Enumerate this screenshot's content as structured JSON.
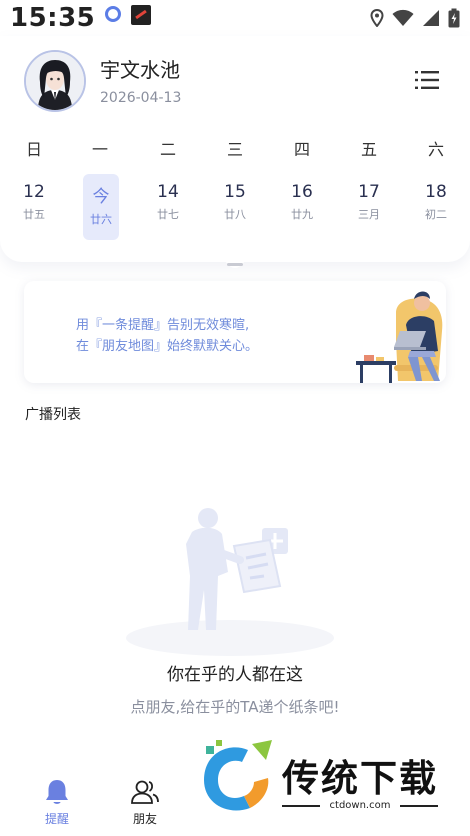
{
  "status_bar": {
    "time": "15:35"
  },
  "profile": {
    "name": "宇文水池",
    "date": "2026-04-13"
  },
  "calendar": {
    "weekdays": [
      "日",
      "一",
      "二",
      "三",
      "四",
      "五",
      "六"
    ],
    "days": [
      {
        "num": "12",
        "lunar": "廿五",
        "selected": false
      },
      {
        "num": "今",
        "lunar": "廿六",
        "selected": true
      },
      {
        "num": "14",
        "lunar": "廿七",
        "selected": false
      },
      {
        "num": "15",
        "lunar": "廿八",
        "selected": false
      },
      {
        "num": "16",
        "lunar": "廿九",
        "selected": false
      },
      {
        "num": "17",
        "lunar": "三月",
        "selected": false
      },
      {
        "num": "18",
        "lunar": "初二",
        "selected": false
      }
    ]
  },
  "banner": {
    "line1": "用『一条提醒』告别无效寒暄,",
    "line2": "在『朋友地图』始终默默关心。"
  },
  "broadcast": {
    "section_title": "广播列表",
    "empty_title": "你在乎的人都在这",
    "empty_subtitle": "点朋友,给在乎的TA递个纸条吧!"
  },
  "bottom_nav": {
    "items": [
      {
        "label": "提醒",
        "icon": "bell-icon",
        "active": true
      },
      {
        "label": "朋友",
        "icon": "friends-icon",
        "active": false
      }
    ]
  },
  "watermark": {
    "text": "传统下载",
    "url": "ctdown.com"
  },
  "colors": {
    "accent": "#6a80e0",
    "selected_bg": "#e6eafb",
    "muted": "#8a8f9e"
  }
}
